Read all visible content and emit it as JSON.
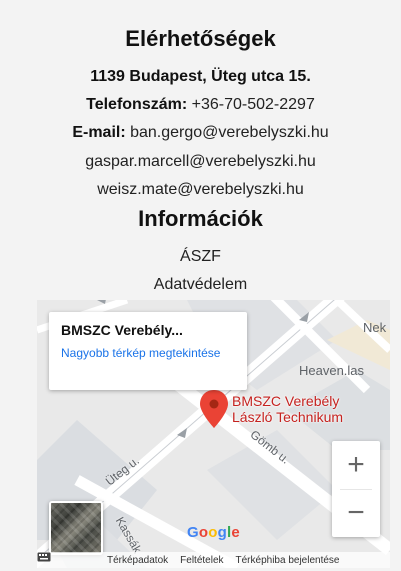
{
  "contact": {
    "heading": "Elérhetőségek",
    "address": "1139 Budapest, Üteg utca 15.",
    "phone_label": "Telefonszám:",
    "phone": "+36-70-502-2297",
    "email_label": "E-mail:",
    "emails": [
      "ban.gergo@verebelyszki.hu",
      "gaspar.marcell@verebelyszki.hu",
      "weisz.mate@verebelyszki.hu"
    ]
  },
  "info": {
    "heading": "Információk",
    "links": [
      "ÁSZF",
      "Adatvédelem"
    ]
  },
  "map": {
    "card_title": "BMSZC Verebély...",
    "card_link": "Nagyobb térkép megtekintése",
    "pin_label_line1": "BMSZC Verebély",
    "pin_label_line2": "László Technikum",
    "streets": [
      "Üteg u.",
      "Gömb u.",
      "Kassák"
    ],
    "places": [
      "Nek",
      "Heaven.las"
    ],
    "zoom_in": "+",
    "zoom_out": "−",
    "google": "Google",
    "footer": [
      "Térképadatok",
      "Feltételek",
      "Térképhiba bejelentése"
    ],
    "colors": {
      "pin": "#ea4335",
      "link": "#1a73e8",
      "label": "#c5221f"
    }
  }
}
